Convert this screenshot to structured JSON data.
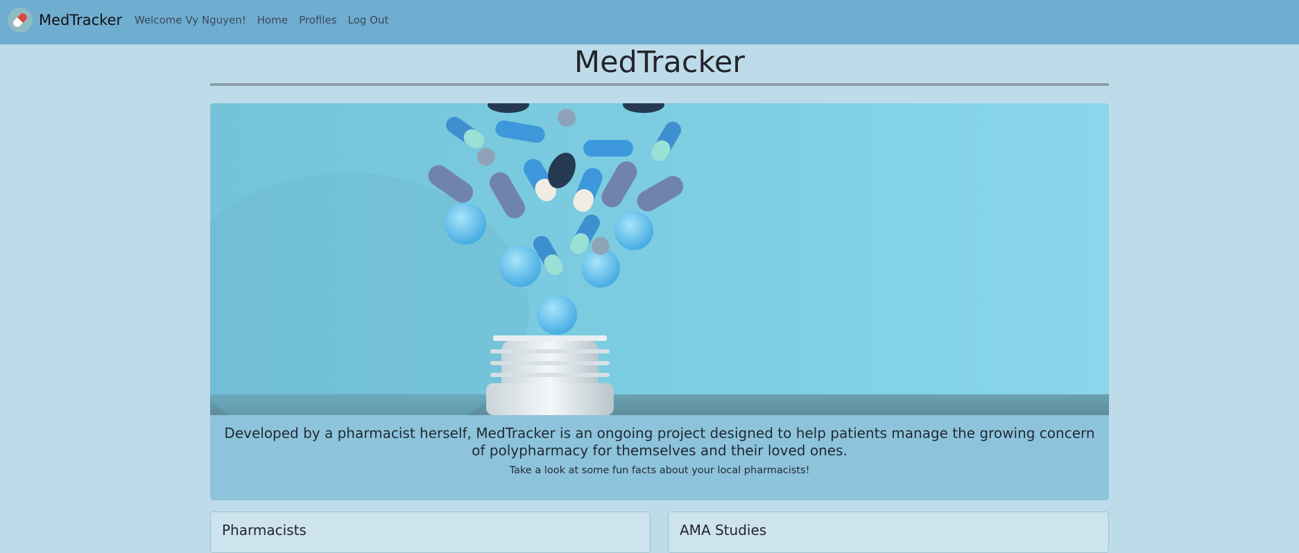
{
  "navbar": {
    "brand": "MedTracker",
    "brand_logo_icon": "pill-capsule-icon",
    "welcome": "Welcome Vy Nguyen!",
    "links": [
      "Home",
      "Profiles",
      "Log Out"
    ]
  },
  "main": {
    "title": "MedTracker",
    "hero": {
      "image_icon": "pills-spilling-from-bottle-photo",
      "lead": "Developed by a pharmacist herself, MedTracker is an ongoing project designed to help patients manage the growing concern of polypharmacy for themselves and their loved ones.",
      "sub": "Take a look at some fun facts about your local pharmacists!"
    },
    "cards": [
      {
        "title": "Pharmacists"
      },
      {
        "title": "AMA Studies"
      }
    ]
  },
  "colors": {
    "navbar": "#6fadd1",
    "page_background": "#bedbea",
    "hero_caption": "#8ec3dc",
    "brand_pill_red": "#d9473f"
  }
}
